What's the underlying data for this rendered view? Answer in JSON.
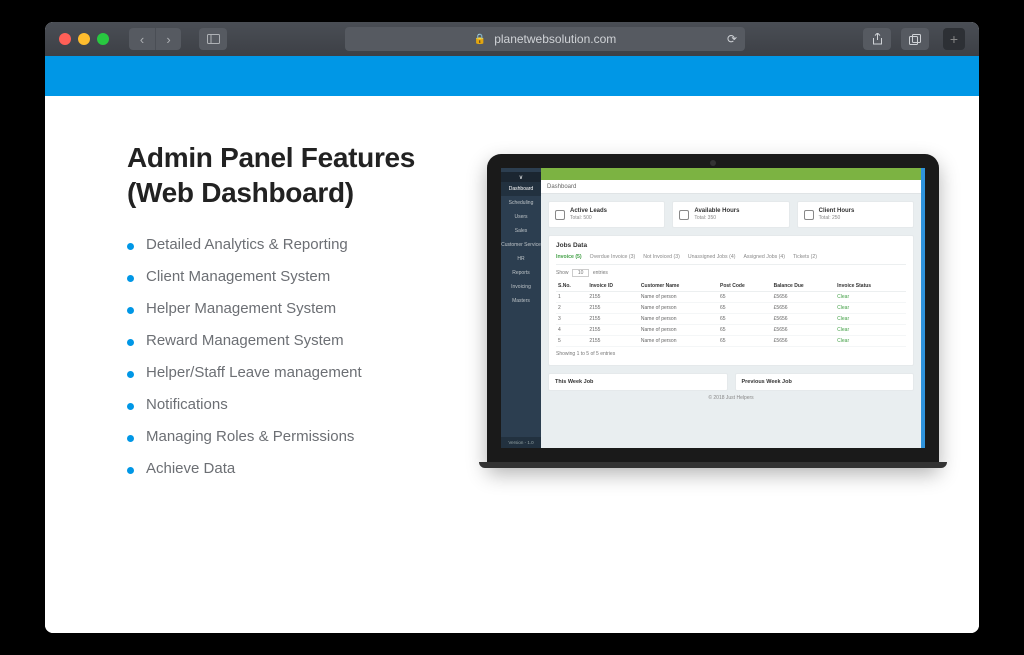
{
  "browser": {
    "url_host": "planetwebsolution.com"
  },
  "page": {
    "heading": "Admin Panel Features (Web Dashboard)",
    "features": [
      "Detailed Analytics & Reporting",
      "Client Management System",
      "Helper Management System",
      "Reward Management System",
      "Helper/Staff Leave management",
      "Notifications",
      "Managing Roles & Permissions",
      "Achieve Data"
    ]
  },
  "dashboard": {
    "sidebar_toggle": "∨",
    "sidebar": [
      "Dashboard",
      "Scheduling",
      "Users",
      "Sales",
      "Customer Service",
      "HR",
      "Reports",
      "Invoicing",
      "Masters"
    ],
    "sidebar_version": "Version - 1.0",
    "breadcrumb": "Dashboard",
    "stats": [
      {
        "label": "Active Leads",
        "sub": "Total: 500"
      },
      {
        "label": "Available Hours",
        "sub": "Total: 350"
      },
      {
        "label": "Client Hours",
        "sub": "Total: 250"
      }
    ],
    "jobs_title": "Jobs Data",
    "tabs": [
      "Invoice (5)",
      "Overdue Invoice (3)",
      "Not Invoiced (3)",
      "Unassigned Jobs (4)",
      "Assigned Jobs (4)",
      "Tickets (2)"
    ],
    "show_label": "Show",
    "show_value": "10",
    "show_tail": "entries",
    "table": {
      "headers": [
        "S.No.",
        "Invoice ID",
        "Customer Name",
        "Post Code",
        "Balance Due",
        "Invoice Status"
      ],
      "rows": [
        [
          "1",
          "2155",
          "Name of person",
          "65",
          "£5656",
          "Clear"
        ],
        [
          "2",
          "2155",
          "Name of person",
          "65",
          "£5656",
          "Clear"
        ],
        [
          "3",
          "2155",
          "Name of person",
          "65",
          "£5656",
          "Clear"
        ],
        [
          "4",
          "2155",
          "Name of person",
          "65",
          "£5656",
          "Clear"
        ],
        [
          "5",
          "2155",
          "Name of person",
          "65",
          "£5656",
          "Clear"
        ]
      ]
    },
    "pager": "Showing 1 to 5 of 5 entries",
    "week_this": "This Week Job",
    "week_prev": "Previous Week Job",
    "footer": "© 2018 Just Helpers"
  }
}
